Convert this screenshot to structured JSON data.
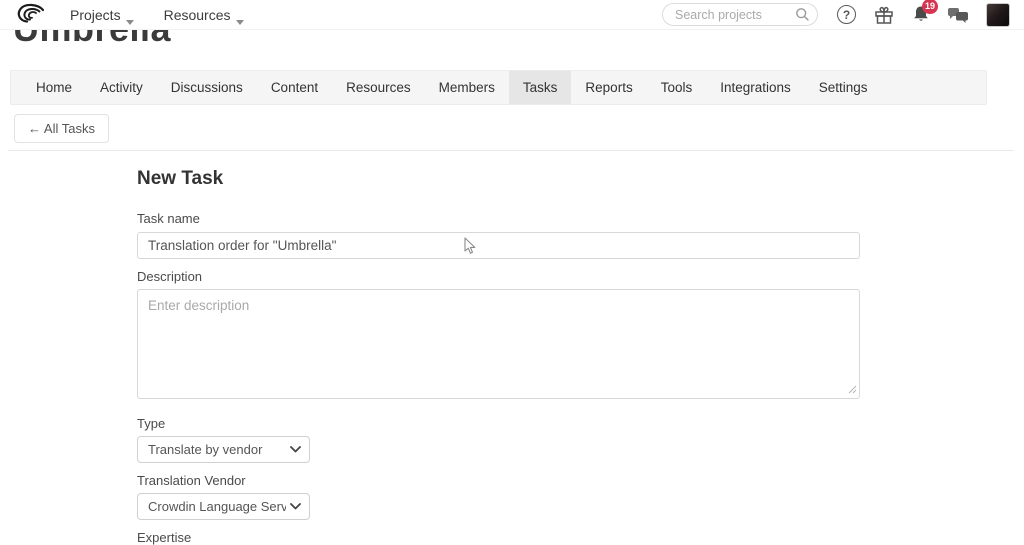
{
  "header": {
    "nav": [
      {
        "label": "Projects"
      },
      {
        "label": "Resources"
      }
    ],
    "search_placeholder": "Search projects",
    "help_glyph": "?",
    "notification_count": "19"
  },
  "page": {
    "project_title": "Umbrella"
  },
  "tabs": {
    "items": [
      "Home",
      "Activity",
      "Discussions",
      "Content",
      "Resources",
      "Members",
      "Tasks",
      "Reports",
      "Tools",
      "Integrations",
      "Settings"
    ],
    "active": "Tasks"
  },
  "toolbar": {
    "back_button": "← All Tasks"
  },
  "form": {
    "heading": "New Task",
    "task_name_label": "Task name",
    "task_name_value": "Translation order for \"Umbrella\"",
    "description_label": "Description",
    "description_placeholder": "Enter description",
    "type_label": "Type",
    "type_value": "Translate by vendor",
    "vendor_label": "Translation Vendor",
    "vendor_value": "Crowdin Language Service",
    "expertise_label": "Expertise"
  },
  "colors": {
    "badge": "#d6354f",
    "tabbar_bg": "#f5f5f5",
    "active_tab_bg": "#e6e6e6"
  }
}
